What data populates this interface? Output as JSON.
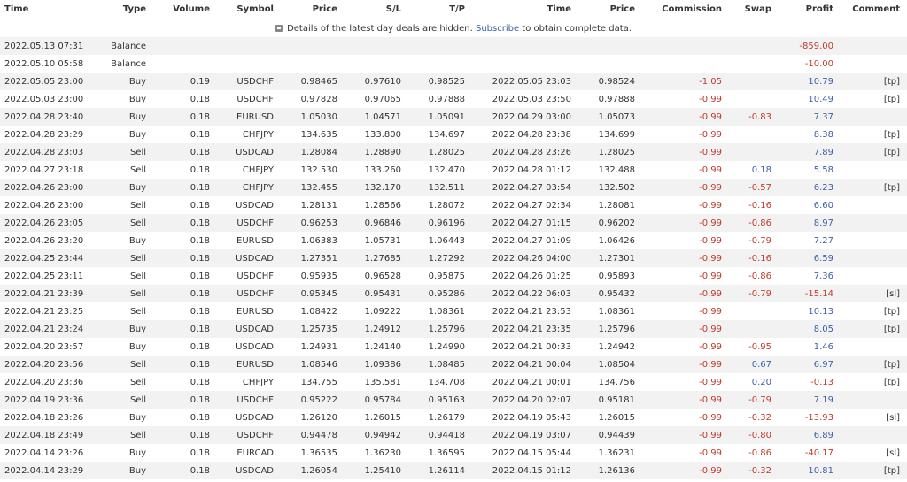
{
  "columns": [
    "Time",
    "Type",
    "Volume",
    "Symbol",
    "Price",
    "S/L",
    "T/P",
    "Time",
    "Price",
    "Commission",
    "Swap",
    "Profit",
    "Comment"
  ],
  "notice": {
    "icon": "info-icon",
    "before": "Details of the latest day deals are hidden. ",
    "link": "Subscribe",
    "after": " to obtain complete data."
  },
  "colors": {
    "negative": "#c0392b",
    "positive": "#3b5ea8"
  },
  "rows": [
    {
      "time": "2022.05.13 07:31",
      "type": "Balance",
      "volume": "",
      "symbol": "",
      "price": "",
      "sl": "",
      "tp": "",
      "close_time": "",
      "close_price": "",
      "commission": "",
      "swap": "",
      "profit": "-859.00",
      "comment": ""
    },
    {
      "time": "2022.05.10 05:58",
      "type": "Balance",
      "volume": "",
      "symbol": "",
      "price": "",
      "sl": "",
      "tp": "",
      "close_time": "",
      "close_price": "",
      "commission": "",
      "swap": "",
      "profit": "-10.00",
      "comment": ""
    },
    {
      "time": "2022.05.05 23:00",
      "type": "Buy",
      "volume": "0.19",
      "symbol": "USDCHF",
      "price": "0.98465",
      "sl": "0.97610",
      "tp": "0.98525",
      "close_time": "2022.05.05 23:03",
      "close_price": "0.98524",
      "commission": "-1.05",
      "swap": "",
      "profit": "10.79",
      "comment": "[tp]"
    },
    {
      "time": "2022.05.03 23:00",
      "type": "Buy",
      "volume": "0.18",
      "symbol": "USDCHF",
      "price": "0.97828",
      "sl": "0.97065",
      "tp": "0.97888",
      "close_time": "2022.05.03 23:50",
      "close_price": "0.97888",
      "commission": "-0.99",
      "swap": "",
      "profit": "10.49",
      "comment": "[tp]"
    },
    {
      "time": "2022.04.28 23:40",
      "type": "Buy",
      "volume": "0.18",
      "symbol": "EURUSD",
      "price": "1.05030",
      "sl": "1.04571",
      "tp": "1.05091",
      "close_time": "2022.04.29 03:00",
      "close_price": "1.05073",
      "commission": "-0.99",
      "swap": "-0.83",
      "profit": "7.37",
      "comment": ""
    },
    {
      "time": "2022.04.28 23:29",
      "type": "Buy",
      "volume": "0.18",
      "symbol": "CHFJPY",
      "price": "134.635",
      "sl": "133.800",
      "tp": "134.697",
      "close_time": "2022.04.28 23:38",
      "close_price": "134.699",
      "commission": "-0.99",
      "swap": "",
      "profit": "8.38",
      "comment": "[tp]"
    },
    {
      "time": "2022.04.28 23:03",
      "type": "Sell",
      "volume": "0.18",
      "symbol": "USDCAD",
      "price": "1.28084",
      "sl": "1.28890",
      "tp": "1.28025",
      "close_time": "2022.04.28 23:26",
      "close_price": "1.28025",
      "commission": "-0.99",
      "swap": "",
      "profit": "7.89",
      "comment": "[tp]"
    },
    {
      "time": "2022.04.27 23:18",
      "type": "Sell",
      "volume": "0.18",
      "symbol": "CHFJPY",
      "price": "132.530",
      "sl": "133.260",
      "tp": "132.470",
      "close_time": "2022.04.28 01:12",
      "close_price": "132.488",
      "commission": "-0.99",
      "swap": "0.18",
      "profit": "5.58",
      "comment": ""
    },
    {
      "time": "2022.04.26 23:00",
      "type": "Buy",
      "volume": "0.18",
      "symbol": "CHFJPY",
      "price": "132.455",
      "sl": "132.170",
      "tp": "132.511",
      "close_time": "2022.04.27 03:54",
      "close_price": "132.502",
      "commission": "-0.99",
      "swap": "-0.57",
      "profit": "6.23",
      "comment": "[tp]"
    },
    {
      "time": "2022.04.26 23:00",
      "type": "Sell",
      "volume": "0.18",
      "symbol": "USDCAD",
      "price": "1.28131",
      "sl": "1.28566",
      "tp": "1.28072",
      "close_time": "2022.04.27 02:34",
      "close_price": "1.28081",
      "commission": "-0.99",
      "swap": "-0.16",
      "profit": "6.60",
      "comment": ""
    },
    {
      "time": "2022.04.26 23:05",
      "type": "Sell",
      "volume": "0.18",
      "symbol": "USDCHF",
      "price": "0.96253",
      "sl": "0.96846",
      "tp": "0.96196",
      "close_time": "2022.04.27 01:15",
      "close_price": "0.96202",
      "commission": "-0.99",
      "swap": "-0.86",
      "profit": "8.97",
      "comment": ""
    },
    {
      "time": "2022.04.26 23:20",
      "type": "Buy",
      "volume": "0.18",
      "symbol": "EURUSD",
      "price": "1.06383",
      "sl": "1.05731",
      "tp": "1.06443",
      "close_time": "2022.04.27 01:09",
      "close_price": "1.06426",
      "commission": "-0.99",
      "swap": "-0.79",
      "profit": "7.27",
      "comment": ""
    },
    {
      "time": "2022.04.25 23:44",
      "type": "Sell",
      "volume": "0.18",
      "symbol": "USDCAD",
      "price": "1.27351",
      "sl": "1.27685",
      "tp": "1.27292",
      "close_time": "2022.04.26 04:00",
      "close_price": "1.27301",
      "commission": "-0.99",
      "swap": "-0.16",
      "profit": "6.59",
      "comment": ""
    },
    {
      "time": "2022.04.25 23:11",
      "type": "Sell",
      "volume": "0.18",
      "symbol": "USDCHF",
      "price": "0.95935",
      "sl": "0.96528",
      "tp": "0.95875",
      "close_time": "2022.04.26 01:25",
      "close_price": "0.95893",
      "commission": "-0.99",
      "swap": "-0.86",
      "profit": "7.36",
      "comment": ""
    },
    {
      "time": "2022.04.21 23:39",
      "type": "Sell",
      "volume": "0.18",
      "symbol": "USDCHF",
      "price": "0.95345",
      "sl": "0.95431",
      "tp": "0.95286",
      "close_time": "2022.04.22 06:03",
      "close_price": "0.95432",
      "commission": "-0.99",
      "swap": "-0.79",
      "profit": "-15.14",
      "comment": "[sl]"
    },
    {
      "time": "2022.04.21 23:25",
      "type": "Sell",
      "volume": "0.18",
      "symbol": "EURUSD",
      "price": "1.08422",
      "sl": "1.09222",
      "tp": "1.08361",
      "close_time": "2022.04.21 23:53",
      "close_price": "1.08361",
      "commission": "-0.99",
      "swap": "",
      "profit": "10.13",
      "comment": "[tp]"
    },
    {
      "time": "2022.04.21 23:24",
      "type": "Buy",
      "volume": "0.18",
      "symbol": "USDCAD",
      "price": "1.25735",
      "sl": "1.24912",
      "tp": "1.25796",
      "close_time": "2022.04.21 23:35",
      "close_price": "1.25796",
      "commission": "-0.99",
      "swap": "",
      "profit": "8.05",
      "comment": "[tp]"
    },
    {
      "time": "2022.04.20 23:57",
      "type": "Buy",
      "volume": "0.18",
      "symbol": "USDCAD",
      "price": "1.24931",
      "sl": "1.24140",
      "tp": "1.24990",
      "close_time": "2022.04.21 00:33",
      "close_price": "1.24942",
      "commission": "-0.99",
      "swap": "-0.95",
      "profit": "1.46",
      "comment": ""
    },
    {
      "time": "2022.04.20 23:56",
      "type": "Sell",
      "volume": "0.18",
      "symbol": "EURUSD",
      "price": "1.08546",
      "sl": "1.09386",
      "tp": "1.08485",
      "close_time": "2022.04.21 00:04",
      "close_price": "1.08504",
      "commission": "-0.99",
      "swap": "0.67",
      "profit": "6.97",
      "comment": "[tp]"
    },
    {
      "time": "2022.04.20 23:36",
      "type": "Sell",
      "volume": "0.18",
      "symbol": "CHFJPY",
      "price": "134.755",
      "sl": "135.581",
      "tp": "134.708",
      "close_time": "2022.04.21 00:01",
      "close_price": "134.756",
      "commission": "-0.99",
      "swap": "0.20",
      "profit": "-0.13",
      "comment": "[tp]"
    },
    {
      "time": "2022.04.19 23:36",
      "type": "Sell",
      "volume": "0.18",
      "symbol": "USDCHF",
      "price": "0.95222",
      "sl": "0.95784",
      "tp": "0.95163",
      "close_time": "2022.04.20 02:07",
      "close_price": "0.95181",
      "commission": "-0.99",
      "swap": "-0.79",
      "profit": "7.19",
      "comment": ""
    },
    {
      "time": "2022.04.18 23:26",
      "type": "Buy",
      "volume": "0.18",
      "symbol": "USDCAD",
      "price": "1.26120",
      "sl": "1.26015",
      "tp": "1.26179",
      "close_time": "2022.04.19 05:43",
      "close_price": "1.26015",
      "commission": "-0.99",
      "swap": "-0.32",
      "profit": "-13.93",
      "comment": "[sl]"
    },
    {
      "time": "2022.04.18 23:49",
      "type": "Sell",
      "volume": "0.18",
      "symbol": "USDCHF",
      "price": "0.94478",
      "sl": "0.94942",
      "tp": "0.94418",
      "close_time": "2022.04.19 03:07",
      "close_price": "0.94439",
      "commission": "-0.99",
      "swap": "-0.80",
      "profit": "6.89",
      "comment": ""
    },
    {
      "time": "2022.04.14 23:26",
      "type": "Buy",
      "volume": "0.18",
      "symbol": "EURCAD",
      "price": "1.36535",
      "sl": "1.36230",
      "tp": "1.36595",
      "close_time": "2022.04.15 05:44",
      "close_price": "1.36231",
      "commission": "-0.99",
      "swap": "-0.86",
      "profit": "-40.17",
      "comment": "[sl]"
    },
    {
      "time": "2022.04.14 23:29",
      "type": "Buy",
      "volume": "0.18",
      "symbol": "USDCAD",
      "price": "1.26054",
      "sl": "1.25410",
      "tp": "1.26114",
      "close_time": "2022.04.15 01:12",
      "close_price": "1.26136",
      "commission": "-0.99",
      "swap": "-0.32",
      "profit": "10.81",
      "comment": "[tp]"
    }
  ]
}
